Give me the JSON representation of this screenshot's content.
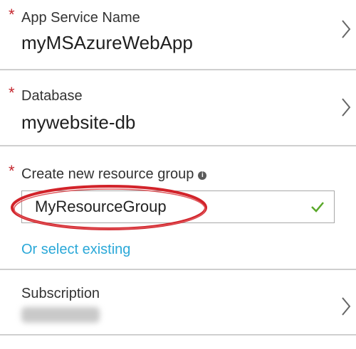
{
  "form": {
    "app_service": {
      "label": "App Service Name",
      "value": "myMSAzureWebApp",
      "required_mark": "*"
    },
    "database": {
      "label": "Database",
      "value": "mywebsite-db",
      "required_mark": "*"
    },
    "resource_group": {
      "label": "Create new resource group",
      "info_icon": "i",
      "value": "MyResourceGroup",
      "required_mark": "*",
      "alt_link": "Or select existing"
    },
    "subscription": {
      "label": "Subscription"
    }
  },
  "colors": {
    "required": "#c4262e",
    "link": "#2aa8d8",
    "valid_check": "#5aa82a",
    "annotation_oval": "#d2232a"
  },
  "icons": [
    "chevron-right-icon",
    "info-icon",
    "checkmark-icon"
  ]
}
